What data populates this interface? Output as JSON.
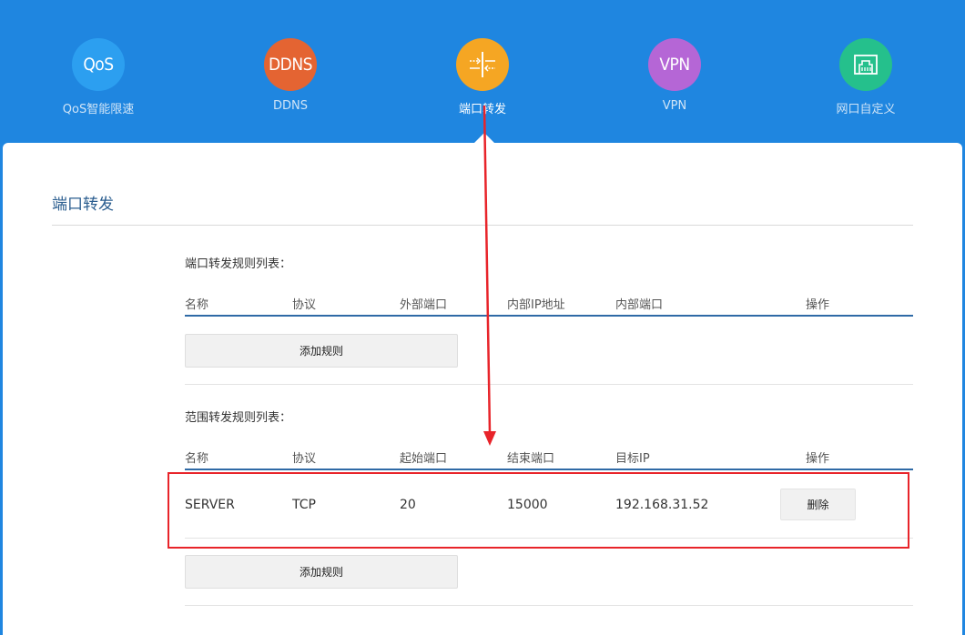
{
  "nav": {
    "items": [
      {
        "key": "qos",
        "icon_text": "QoS",
        "label": "QoS智能限速",
        "color": "#2c9ff0"
      },
      {
        "key": "ddns",
        "icon_text": "DDNS",
        "label": "DDNS",
        "color": "#e46432"
      },
      {
        "key": "port-forward",
        "icon_text": "",
        "label": "端口转发",
        "color": "#f5a623",
        "active": true
      },
      {
        "key": "vpn",
        "icon_text": "VPN",
        "label": "VPN",
        "color": "#b566d6"
      },
      {
        "key": "port-custom",
        "icon_text": "",
        "label": "网口自定义",
        "color": "#25c08c"
      }
    ]
  },
  "page": {
    "title": "端口转发"
  },
  "port_rules": {
    "title": "端口转发规则列表：",
    "columns": [
      "名称",
      "协议",
      "外部端口",
      "内部IP地址",
      "内部端口",
      "操作"
    ],
    "rows": [],
    "add_button": "添加规则"
  },
  "range_rules": {
    "title": "范围转发规则列表：",
    "columns": [
      "名称",
      "协议",
      "起始端口",
      "结束端口",
      "目标IP",
      "操作"
    ],
    "rows": [
      {
        "name": "SERVER",
        "protocol": "TCP",
        "start_port": "20",
        "end_port": "15000",
        "target_ip": "192.168.31.52",
        "action": "删除"
      }
    ],
    "add_button": "添加规则"
  },
  "annotations": {
    "color": "#e8242a"
  }
}
